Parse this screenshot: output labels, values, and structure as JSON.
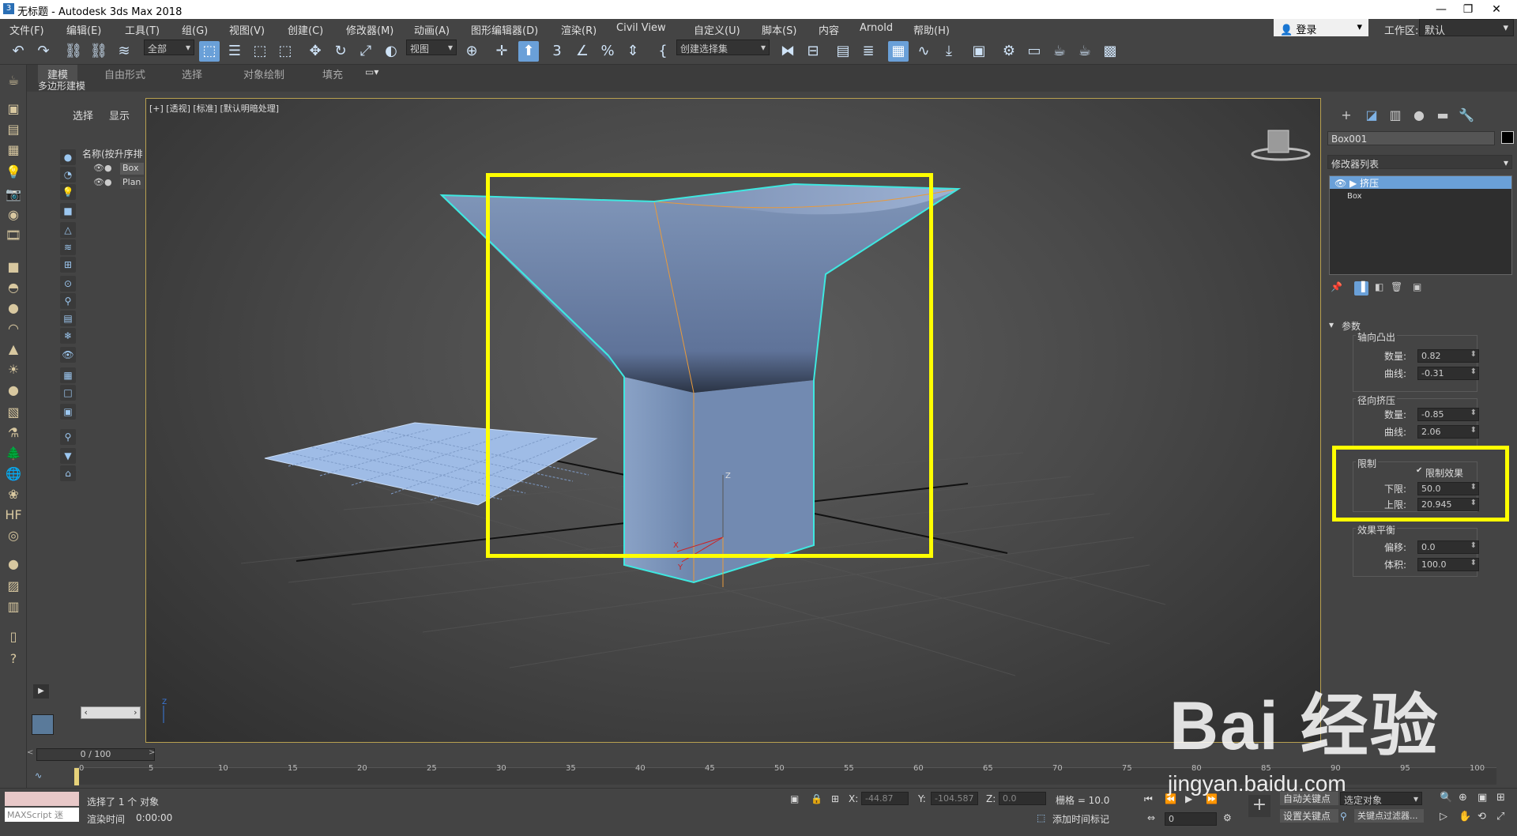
{
  "titlebar": {
    "title": "无标题 - Autodesk 3ds Max 2018",
    "app_icon": "3"
  },
  "menu": [
    "文件(F)",
    "编辑(E)",
    "工具(T)",
    "组(G)",
    "视图(V)",
    "创建(C)",
    "修改器(M)",
    "动画(A)",
    "图形编辑器(D)",
    "渲染(R)",
    "Civil View",
    "自定义(U)",
    "脚本(S)",
    "内容",
    "Arnold",
    "帮助(H)"
  ],
  "login": "登录",
  "workspace": {
    "label": "工作区:",
    "value": "默认"
  },
  "toolbar": {
    "selection_filter": "全部",
    "ref_coord": "视图",
    "named_selection": "创建选择集"
  },
  "ribbon": {
    "tabs": [
      "建模",
      "自由形式",
      "选择",
      "对象绘制",
      "填充"
    ],
    "active_tab": "建模",
    "sub_label": "多边形建模"
  },
  "scene_explorer": {
    "tabs": [
      "选择",
      "显示"
    ],
    "column_header": "名称(按升序排",
    "items": [
      "Box",
      "Plan"
    ]
  },
  "viewport": {
    "label": "[+] [透视] [标准] [默认明暗处理]",
    "axis_z": "Z",
    "axis_x": "X",
    "axis_y": "Y"
  },
  "command_panel": {
    "object_name": "Box001",
    "modifier_list": "修改器列表",
    "stack": [
      "挤压",
      "Box"
    ],
    "rollout": "参数",
    "axial": {
      "title": "轴向凸出",
      "amount_label": "数量:",
      "amount": "0.82",
      "curve_label": "曲线:",
      "curve": "-0.31"
    },
    "radial": {
      "title": "径向挤压",
      "amount_label": "数量:",
      "amount": "-0.85",
      "curve_label": "曲线:",
      "curve": "2.06"
    },
    "limits": {
      "title": "限制",
      "checkbox": "限制效果",
      "lower_label": "下限:",
      "lower": "50.0",
      "upper_label": "上限:",
      "upper": "20.945"
    },
    "balance": {
      "title": "效果平衡",
      "bias_label": "偏移:",
      "bias": "0.0",
      "volume_label": "体积:",
      "volume": "100.0"
    }
  },
  "timeline": {
    "frame": "0 / 100",
    "ticks": [
      "0",
      "5",
      "10",
      "15",
      "20",
      "25",
      "30",
      "35",
      "40",
      "45",
      "50",
      "55",
      "60",
      "65",
      "70",
      "75",
      "80",
      "85",
      "90",
      "95",
      "100"
    ]
  },
  "status": {
    "maxscript": "MAXScript 迷",
    "selected": "选择了 1 个 对象",
    "render_time_label": "渲染时间",
    "render_time": "0:00:00",
    "x_label": "X:",
    "x": "-44.87",
    "y_label": "Y:",
    "y": "-104.587",
    "z_label": "Z:",
    "z": "0.0",
    "grid": "栅格 = 10.0",
    "add_time_tag": "添加时间标记",
    "auto_key": "自动关键点",
    "selected_object": "选定对象",
    "set_key": "设置关键点",
    "key_filter": "关键点过滤器...",
    "current_frame": "0"
  },
  "watermark": {
    "logo": "Bai 经验",
    "url": "jingyan.baidu.com"
  },
  "highlight_color": "#ffff00",
  "accent_color": "#6aa0d8"
}
